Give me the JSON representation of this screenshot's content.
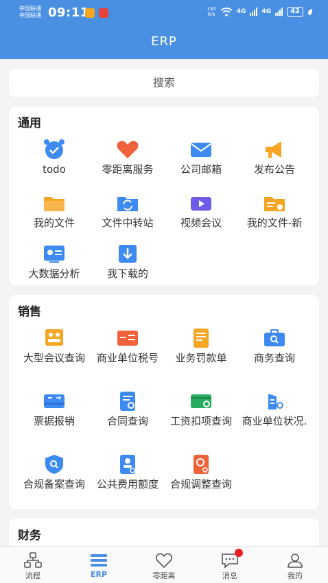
{
  "status": {
    "carrier1": "中国联通",
    "carrier2": "中国联通",
    "time": "09:11",
    "netspeed_value": "130",
    "netspeed_unit": "K/s",
    "sig1": "4G",
    "sig2": "4G",
    "battery": "42"
  },
  "header": {
    "title": "ERP"
  },
  "search": {
    "label": "搜索"
  },
  "sections": {
    "general": {
      "title": "通用",
      "items": [
        "todo",
        "零距离服务",
        "公司邮箱",
        "发布公告",
        "我的文件",
        "文件中转站",
        "视频会议",
        "我的文件-新",
        "大数据分析",
        "我下载的"
      ]
    },
    "sales": {
      "title": "销售",
      "items": [
        "大型会议查询",
        "商业单位税号",
        "业务罚款单",
        "商务查询",
        "票据报销",
        "合同查询",
        "工资扣项查询",
        "商业单位状况.",
        "合规备案查询",
        "公共费用额度",
        "合规调整查询"
      ]
    },
    "finance": {
      "title": "财务"
    }
  },
  "tabbar": {
    "flow": "流程",
    "erp": "ERP",
    "zero": "零距离",
    "msg": "消息",
    "mine": "我的"
  },
  "colors": {
    "primary": "#4a90e2",
    "badge": "#ee1c25"
  }
}
